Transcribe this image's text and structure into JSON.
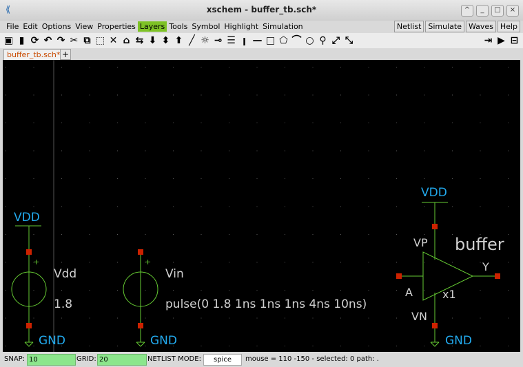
{
  "window": {
    "title": "xschem - buffer_tb.sch*",
    "controls": [
      "^",
      "_",
      "□",
      "×"
    ]
  },
  "menubar": {
    "items": [
      "File",
      "Edit",
      "Options",
      "View",
      "Properties",
      "Layers",
      "Tools",
      "Symbol",
      "Highlight",
      "Simulation"
    ],
    "active_item": "Layers",
    "right_buttons": [
      "Netlist",
      "Simulate",
      "Waves",
      "Help"
    ]
  },
  "toolbar": {
    "icons": [
      "open-icon",
      "save-icon",
      "reload-icon",
      "undo-icon",
      "redo-icon",
      "cut-icon",
      "copy-icon",
      "paste-icon",
      "delete-icon",
      "place-symbol-icon",
      "move-icon",
      "push-icon",
      "pop-icon",
      "up-icon",
      "wire-icon",
      "highlight-icon",
      "pin-icon",
      "text-icon",
      "line-icon",
      "line2-icon",
      "rect-icon",
      "polygon-icon",
      "arc-icon",
      "circle-icon",
      "zoom-icon",
      "zoom-in-icon",
      "zoom-out-icon"
    ],
    "right_icons": [
      "netlist-icon",
      "run-icon",
      "waves-icon"
    ]
  },
  "tabs": {
    "active": "buffer_tb.sch*",
    "add_label": "+"
  },
  "schematic": {
    "colors": {
      "background": "#000000",
      "wire": "#66cc33",
      "pin": "#cc2200",
      "net_label": "#22aaee",
      "text": "#d0d0d0"
    },
    "vdd_source": {
      "name": "Vdd",
      "value": "1.8",
      "top_net": "VDD",
      "bottom_net": "GND"
    },
    "vin_source": {
      "name": "Vin",
      "value": "pulse(0 1.8 1ns 1ns 1ns 4ns 10ns)",
      "bottom_net": "GND"
    },
    "buffer": {
      "title": "buffer",
      "instance": "x1",
      "input": "A",
      "output": "Y",
      "vp": "VP",
      "vn": "VN",
      "top_net": "VDD",
      "bottom_net": "GND"
    },
    "plus_sign": "+"
  },
  "status": {
    "snap_label": "SNAP:",
    "snap_value": "10",
    "grid_label": "GRID:",
    "grid_value": "20",
    "netlist_label": "NETLIST MODE:",
    "netlist_mode": "spice",
    "info": "mouse = 110 -150 - selected: 0 path: ."
  }
}
